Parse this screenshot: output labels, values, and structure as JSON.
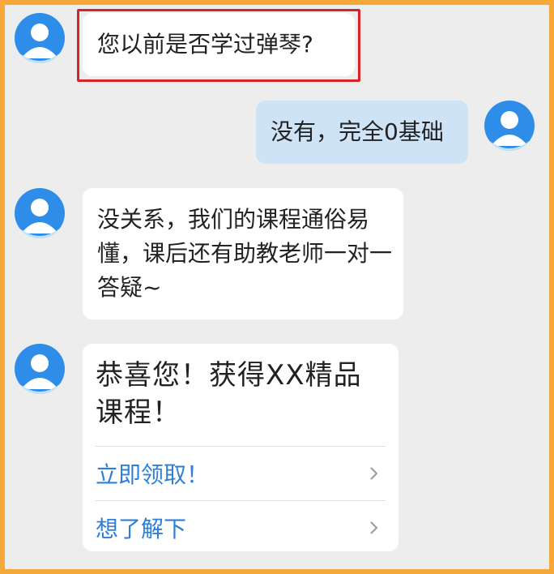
{
  "messages": [
    {
      "from": "agent",
      "text": "您以前是否学过弹琴?"
    },
    {
      "from": "user",
      "text": "没有，完全0基础"
    },
    {
      "from": "agent",
      "text": "没关系，我们的课程通俗易懂，课后还有助教老师一对一答疑~"
    }
  ],
  "card": {
    "title": "恭喜您！获得XX精品课程！",
    "actions": [
      {
        "label": "立即领取！"
      },
      {
        "label": "想了解下"
      }
    ]
  },
  "colors": {
    "outer_border": "#F7A83B",
    "background": "#EDEDED",
    "agent_bubble": "#FFFFFF",
    "user_bubble": "#CFE3F7",
    "avatar": "#2E8DE8",
    "highlight_box": "#D9232B",
    "link": "#2F7FD8"
  },
  "icons": {
    "avatar": "user-avatar-icon",
    "action_arrow": "chevron-right-icon"
  }
}
